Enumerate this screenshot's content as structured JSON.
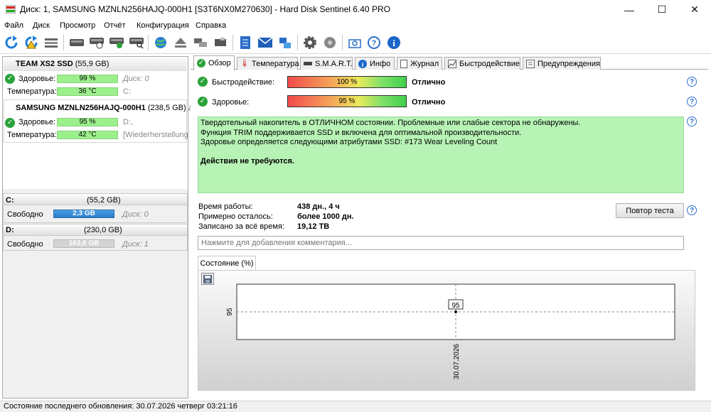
{
  "window": {
    "title": "Диск: 1, SAMSUNG MZNLN256HAJQ-000H1 [S3T6NX0M270630]  -  Hard Disk Sentinel 6.40 PRO",
    "minimize": "—",
    "maximize": "☐",
    "close": "✕"
  },
  "menu": [
    "Файл",
    "Диск",
    "Просмотр",
    "Отчёт",
    "Конфигурация",
    "Справка"
  ],
  "toolbar_icons": [
    "refresh-icon",
    "refresh-warning-icon",
    "disk-list-icon",
    "disk-icon",
    "disk-clock-icon",
    "disk-check-icon",
    "disk-search-icon",
    "globe-icon",
    "eject-icon",
    "disk-transfer-icon",
    "disk-chip-icon",
    "notes-icon",
    "mail-icon",
    "network-icon",
    "gear-icon",
    "sound-icon",
    "screenshot-icon",
    "help-icon",
    "info-icon"
  ],
  "drives": [
    {
      "name": "TEAM XS2 SSD",
      "size": "(55,9 GB)",
      "health_label": "Здоровье:",
      "health_value": "99 %",
      "health_extra": "Диск: 0",
      "temp_label": "Температура:",
      "temp_value": "36 °C",
      "temp_extra": "C:"
    },
    {
      "name": "SAMSUNG MZNLN256HAJQ-000H1",
      "size": "(238,5 GB)",
      "size_extra": "Ди",
      "health_label": "Здоровье:",
      "health_value": "95 %",
      "health_extra": "D:,",
      "temp_label": "Температура:",
      "temp_value": "42 °C",
      "temp_extra": "[Wiederherstellung"
    }
  ],
  "volumes": [
    {
      "letter": "C:",
      "size": "(55,2 GB)",
      "free_label": "Свободно",
      "free_value": "2,3 GB",
      "disk": "Диск: 0"
    },
    {
      "letter": "D:",
      "size": "(230,0 GB)",
      "free_label": "Свободно",
      "free_value": "163,6 GB",
      "disk": "Диск: 1"
    }
  ],
  "tabs": [
    {
      "label": "Обзор",
      "icon": "check-icon"
    },
    {
      "label": "Температура",
      "icon": "thermometer-icon"
    },
    {
      "label": "S.M.A.R.T.",
      "icon": "smart-icon"
    },
    {
      "label": "Инфо",
      "icon": "info-icon"
    },
    {
      "label": "Журнал",
      "icon": "journal-icon"
    },
    {
      "label": "Быстродействие",
      "icon": "performance-icon"
    },
    {
      "label": "Предупреждения",
      "icon": "warnings-icon"
    }
  ],
  "overview": {
    "performance_label": "Быстродействие:",
    "performance_value": "100 %",
    "performance_percent": 100,
    "performance_status": "Отлично",
    "health_label": "Здоровье:",
    "health_value": "95 %",
    "health_percent": 95,
    "health_status": "Отлично",
    "message_lines": [
      "Твердотельный накопитель в ОТЛИЧНОМ состоянии. Проблемные или слабые сектора не обнаружены.",
      "Функция TRIM поддерживается SSD и включена для оптимальной производительности.",
      "Здоровье определяется следующими атрибутами SSD: #173 Wear Leveling Count"
    ],
    "message_action": "Действия не требуются.",
    "uptime_label": "Время работы:",
    "uptime_value": "438 дн., 4 ч",
    "remaining_label": "Примерно осталось:",
    "remaining_value": "более 1000 дн.",
    "written_label": "Записано за всё время:",
    "written_value": "19,12 TB",
    "retest_button": "Повтор теста",
    "comment_placeholder": "Нажмите для добавления комментария..."
  },
  "chart_tab": "Состояние (%)",
  "chart_data": {
    "type": "line",
    "x": [
      "30.07.2026"
    ],
    "series": [
      {
        "values": [
          95
        ]
      }
    ],
    "y_tick_labels": [
      "95"
    ],
    "x_tick_labels": [
      "30.07.2026"
    ],
    "data_labels": [
      "95"
    ],
    "grid": true
  },
  "statusbar": "Состояние последнего обновления: 30.07.2026 четверг 03:21:16",
  "colors": {
    "accent_blue": "#2f6fd1",
    "ok_green": "#2aa33a",
    "message_bg": "#b8f3b6",
    "health_bar": "#9cf08c"
  }
}
